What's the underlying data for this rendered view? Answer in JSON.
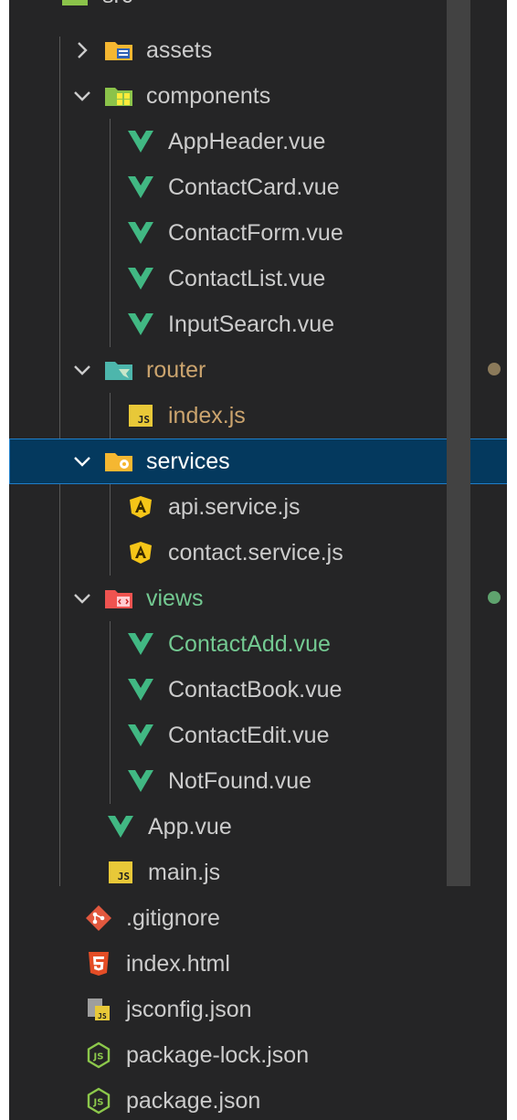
{
  "colors": {
    "panel_bg": "#252526",
    "selected_bg": "#04395e",
    "selected_border": "#1f7ec9",
    "text": "#cccccc",
    "modified": "#cba46e",
    "untracked": "#73c991",
    "vue_green": "#41b883",
    "js_yellow": "#e8c838",
    "html_orange": "#e44d26",
    "git_orange": "#e2583e",
    "node_green": "#8cc84b",
    "angular_yellow": "#f5c518"
  },
  "tree": {
    "root_label": "src",
    "assets": {
      "label": "assets",
      "icon": "folder-assets-icon"
    },
    "components": {
      "label": "components",
      "icon": "folder-components-icon",
      "files": [
        "AppHeader.vue",
        "ContactCard.vue",
        "ContactForm.vue",
        "ContactList.vue",
        "InputSearch.vue"
      ]
    },
    "router": {
      "label": "router",
      "icon": "folder-router-icon",
      "file": "index.js",
      "file_badge": "M"
    },
    "services": {
      "label": "services",
      "icon": "folder-services-icon",
      "files": [
        "api.service.js",
        "contact.service.js"
      ]
    },
    "views": {
      "label": "views",
      "icon": "folder-views-icon",
      "files": [
        "ContactAdd.vue",
        "ContactBook.vue",
        "ContactEdit.vue",
        "NotFound.vue"
      ],
      "added_badge": "U"
    },
    "src_files": [
      "App.vue",
      "main.js"
    ],
    "root_files": [
      ".gitignore",
      "index.html",
      "jsconfig.json",
      "package-lock.json",
      "package.json"
    ]
  }
}
